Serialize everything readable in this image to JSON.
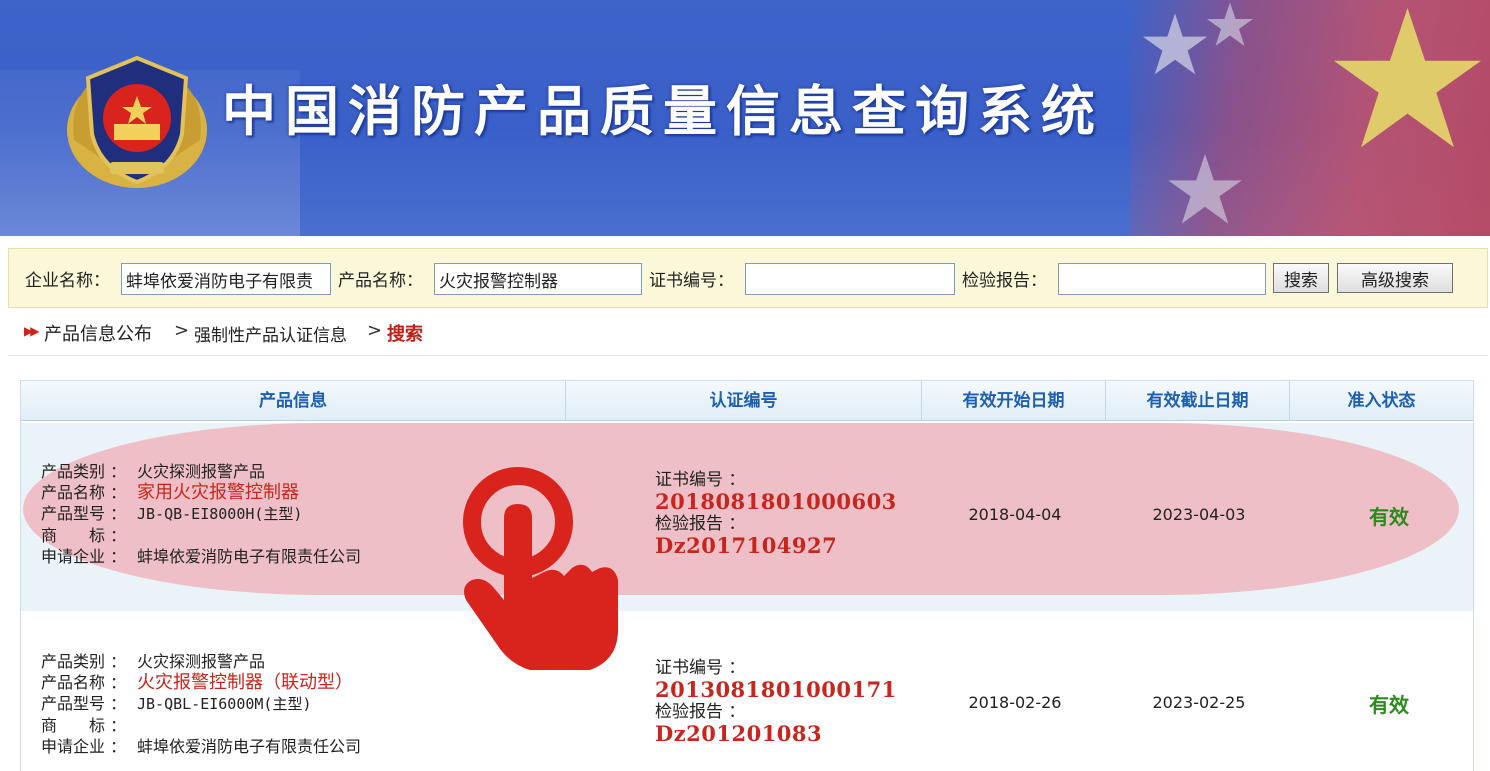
{
  "banner": {
    "title": "中国消防产品质量信息查询系统",
    "emblem": "police-emblem-icon"
  },
  "search": {
    "company_label": "企业名称：",
    "company_value": "蚌埠依爱消防电子有限责",
    "product_label": "产品名称：",
    "product_value": "火灾报警控制器",
    "cert_label": "证书编号：",
    "cert_value": "",
    "report_label": "检验报告：",
    "report_value": "",
    "search_button": "搜索",
    "advanced_button": "高级搜索"
  },
  "breadcrumb": {
    "item1": "产品信息公布",
    "item2": "强制性产品认证信息",
    "current": "搜索",
    "separator": ">"
  },
  "table": {
    "headers": [
      "产品信息",
      "认证编号",
      "有效开始日期",
      "有效截止日期",
      "准入状态"
    ],
    "rows": [
      {
        "category_label": "产品类别 ：",
        "category": "火灾探测报警产品",
        "name_label": "产品名称 ：",
        "name": "家用火灾报警控制器",
        "model_label": "产品型号 ：",
        "model": "JB-QB-EI8000H(主型)",
        "brand_label": "商　　标 ：",
        "brand": "",
        "applicant_label": "申请企业 ：",
        "applicant": "蚌埠依爱消防电子有限责任公司",
        "cert_label": "证书编号 ：",
        "cert_no": "2018081801000603",
        "report_label": "检验报告 ：",
        "report_no": "Dz2017104927",
        "start": "2018-04-04",
        "end": "2023-04-03",
        "status": "有效"
      },
      {
        "category_label": "产品类别 ：",
        "category": "火灾探测报警产品",
        "name_label": "产品名称 ：",
        "name": "火灾报警控制器（联动型）",
        "model_label": "产品型号 ：",
        "model": "JB-QBL-EI6000M(主型)",
        "brand_label": "商　　标 ：",
        "brand": "",
        "applicant_label": "申请企业 ：",
        "applicant": "蚌埠依爱消防电子有限责任公司",
        "cert_label": "证书编号 ：",
        "cert_no": "2013081801000171",
        "report_label": "检验报告 ：",
        "report_no": "Dz201201083",
        "start": "2018-02-26",
        "end": "2023-02-25",
        "status": "有效"
      }
    ]
  },
  "colors": {
    "banner_blue": "#3e63c9",
    "accent_red": "#c8261c",
    "header_blue": "#1d5fb0",
    "status_green": "#2d8a1e",
    "highlight_pink": "#f0aab4"
  },
  "overlay": {
    "icon": "tap-hand-icon"
  }
}
